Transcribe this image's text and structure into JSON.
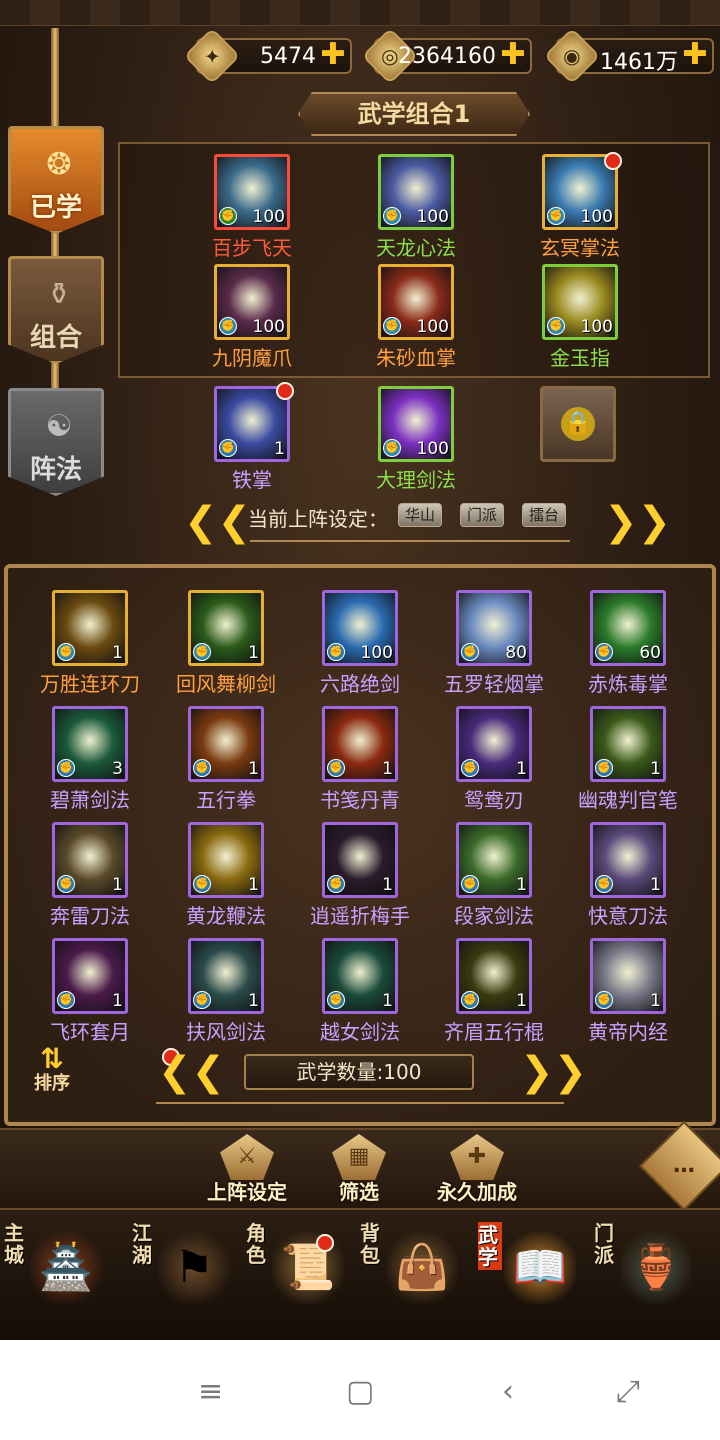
{
  "resources": [
    {
      "icon": "sword-scroll-icon",
      "glyph": "✦",
      "value": "5474"
    },
    {
      "icon": "gold-coin-icon",
      "glyph": "◎",
      "value": "2364160"
    },
    {
      "icon": "silver-coin-icon",
      "glyph": "◉",
      "value": "1461万"
    }
  ],
  "plus": "✚",
  "banner_title": "武学组合1",
  "tabs": [
    {
      "label": "已学",
      "glyph": "❂"
    },
    {
      "label": "组合",
      "glyph": "⚱"
    },
    {
      "label": "阵法",
      "glyph": "☯"
    }
  ],
  "equipped": [
    {
      "name": "百步飞天",
      "level": "100",
      "color": "#ff5a3a",
      "frame": "red",
      "art": "#3a6a8a"
    },
    {
      "name": "天龙心法",
      "level": "100",
      "color": "#8be04a",
      "frame": "green",
      "art": "#4a5aa0"
    },
    {
      "name": "玄冥掌法",
      "level": "100",
      "color": "#ffa040",
      "frame": "gold",
      "art": "#3a7ab0"
    },
    {
      "name": "九阴魔爪",
      "level": "100",
      "color": "#ffa040",
      "frame": "gold",
      "art": "#5a2a4a"
    },
    {
      "name": "朱砂血掌",
      "level": "100",
      "color": "#ffa040",
      "frame": "gold",
      "art": "#8a2a1a"
    },
    {
      "name": "金玉指",
      "level": "100",
      "color": "#8be04a",
      "frame": "green",
      "art": "#9a8a20"
    },
    {
      "name": "铁掌",
      "level": "1",
      "color": "#c9a0ff",
      "frame": "purple",
      "art": "#3a4aa0"
    },
    {
      "name": "大理剑法",
      "level": "100",
      "color": "#8be04a",
      "frame": "green",
      "art": "#7a30c0"
    }
  ],
  "setting_label": "当前上阵设定：",
  "setting_tags": [
    "华山",
    "门派",
    "擂台"
  ],
  "inventory": [
    {
      "name": "万胜连环刀",
      "level": "1",
      "color": "#ffa040",
      "frame": "gold",
      "art": "#6a4a10"
    },
    {
      "name": "回风舞柳剑",
      "level": "1",
      "color": "#ffa040",
      "frame": "gold",
      "art": "#2a5a1a"
    },
    {
      "name": "六路绝剑",
      "level": "100",
      "color": "#c9a0ff",
      "frame": "purple",
      "art": "#2a6ab0"
    },
    {
      "name": "五罗轻烟掌",
      "level": "80",
      "color": "#c9a0ff",
      "frame": "purple",
      "art": "#6a8ac0"
    },
    {
      "name": "赤炼毒掌",
      "level": "60",
      "color": "#c9a0ff",
      "frame": "purple",
      "art": "#2a7a2a"
    },
    {
      "name": "碧萧剑法",
      "level": "3",
      "color": "#c9a0ff",
      "frame": "purple",
      "art": "#1a5a3a"
    },
    {
      "name": "五行拳",
      "level": "1",
      "color": "#c9a0ff",
      "frame": "purple",
      "art": "#7a3a10"
    },
    {
      "name": "书笺丹青",
      "level": "1",
      "color": "#c9a0ff",
      "frame": "purple",
      "art": "#8a2a10"
    },
    {
      "name": "鸳鸯刃",
      "level": "1",
      "color": "#c9a0ff",
      "frame": "purple",
      "art": "#4a2a7a"
    },
    {
      "name": "幽魂判官笔",
      "level": "1",
      "color": "#c9a0ff",
      "frame": "purple",
      "art": "#3a5a1a"
    },
    {
      "name": "奔雷刀法",
      "level": "1",
      "color": "#c9a0ff",
      "frame": "purple",
      "art": "#5a4a2a"
    },
    {
      "name": "黄龙鞭法",
      "level": "1",
      "color": "#c9a0ff",
      "frame": "purple",
      "art": "#8a6a10"
    },
    {
      "name": "逍遥折梅手",
      "level": "1",
      "color": "#c9a0ff",
      "frame": "purple",
      "art": "#2a1a2a"
    },
    {
      "name": "段家剑法",
      "level": "1",
      "color": "#c9a0ff",
      "frame": "purple",
      "art": "#3a6a2a"
    },
    {
      "name": "快意刀法",
      "level": "1",
      "color": "#c9a0ff",
      "frame": "purple",
      "art": "#5a4a7a"
    },
    {
      "name": "飞环套月",
      "level": "1",
      "color": "#c9a0ff",
      "frame": "purple",
      "art": "#4a1a4a"
    },
    {
      "name": "扶风剑法",
      "level": "1",
      "color": "#c9a0ff",
      "frame": "purple",
      "art": "#2a4a4a"
    },
    {
      "name": "越女剑法",
      "level": "1",
      "color": "#c9a0ff",
      "frame": "purple",
      "art": "#1a4a3a"
    },
    {
      "name": "齐眉五行棍",
      "level": "1",
      "color": "#c9a0ff",
      "frame": "purple",
      "art": "#3a3a10"
    },
    {
      "name": "黄帝内经",
      "level": "1",
      "color": "#c9a0ff",
      "frame": "purple",
      "art": "#7a7a8a"
    }
  ],
  "sort_label": "排序",
  "count_label": "武学数量:100",
  "actions": [
    {
      "label": "上阵设定",
      "glyph": "⚔"
    },
    {
      "label": "筛选",
      "glyph": "▦"
    },
    {
      "label": "永久加成",
      "glyph": "✚"
    }
  ],
  "chat_glyph": "…",
  "nav": [
    {
      "label": "主城",
      "glyph": "🏯"
    },
    {
      "label": "江湖",
      "glyph": "⚑"
    },
    {
      "label": "角色",
      "glyph": "📜"
    },
    {
      "label": "背包",
      "glyph": "👜"
    },
    {
      "label": "武学",
      "glyph": "📖"
    },
    {
      "label": "门派",
      "glyph": "🏺"
    }
  ],
  "arrow_left": "❮❮",
  "arrow_right": "❯❯",
  "system_nav": [
    "≡",
    "▢",
    "‹",
    "⤢"
  ]
}
